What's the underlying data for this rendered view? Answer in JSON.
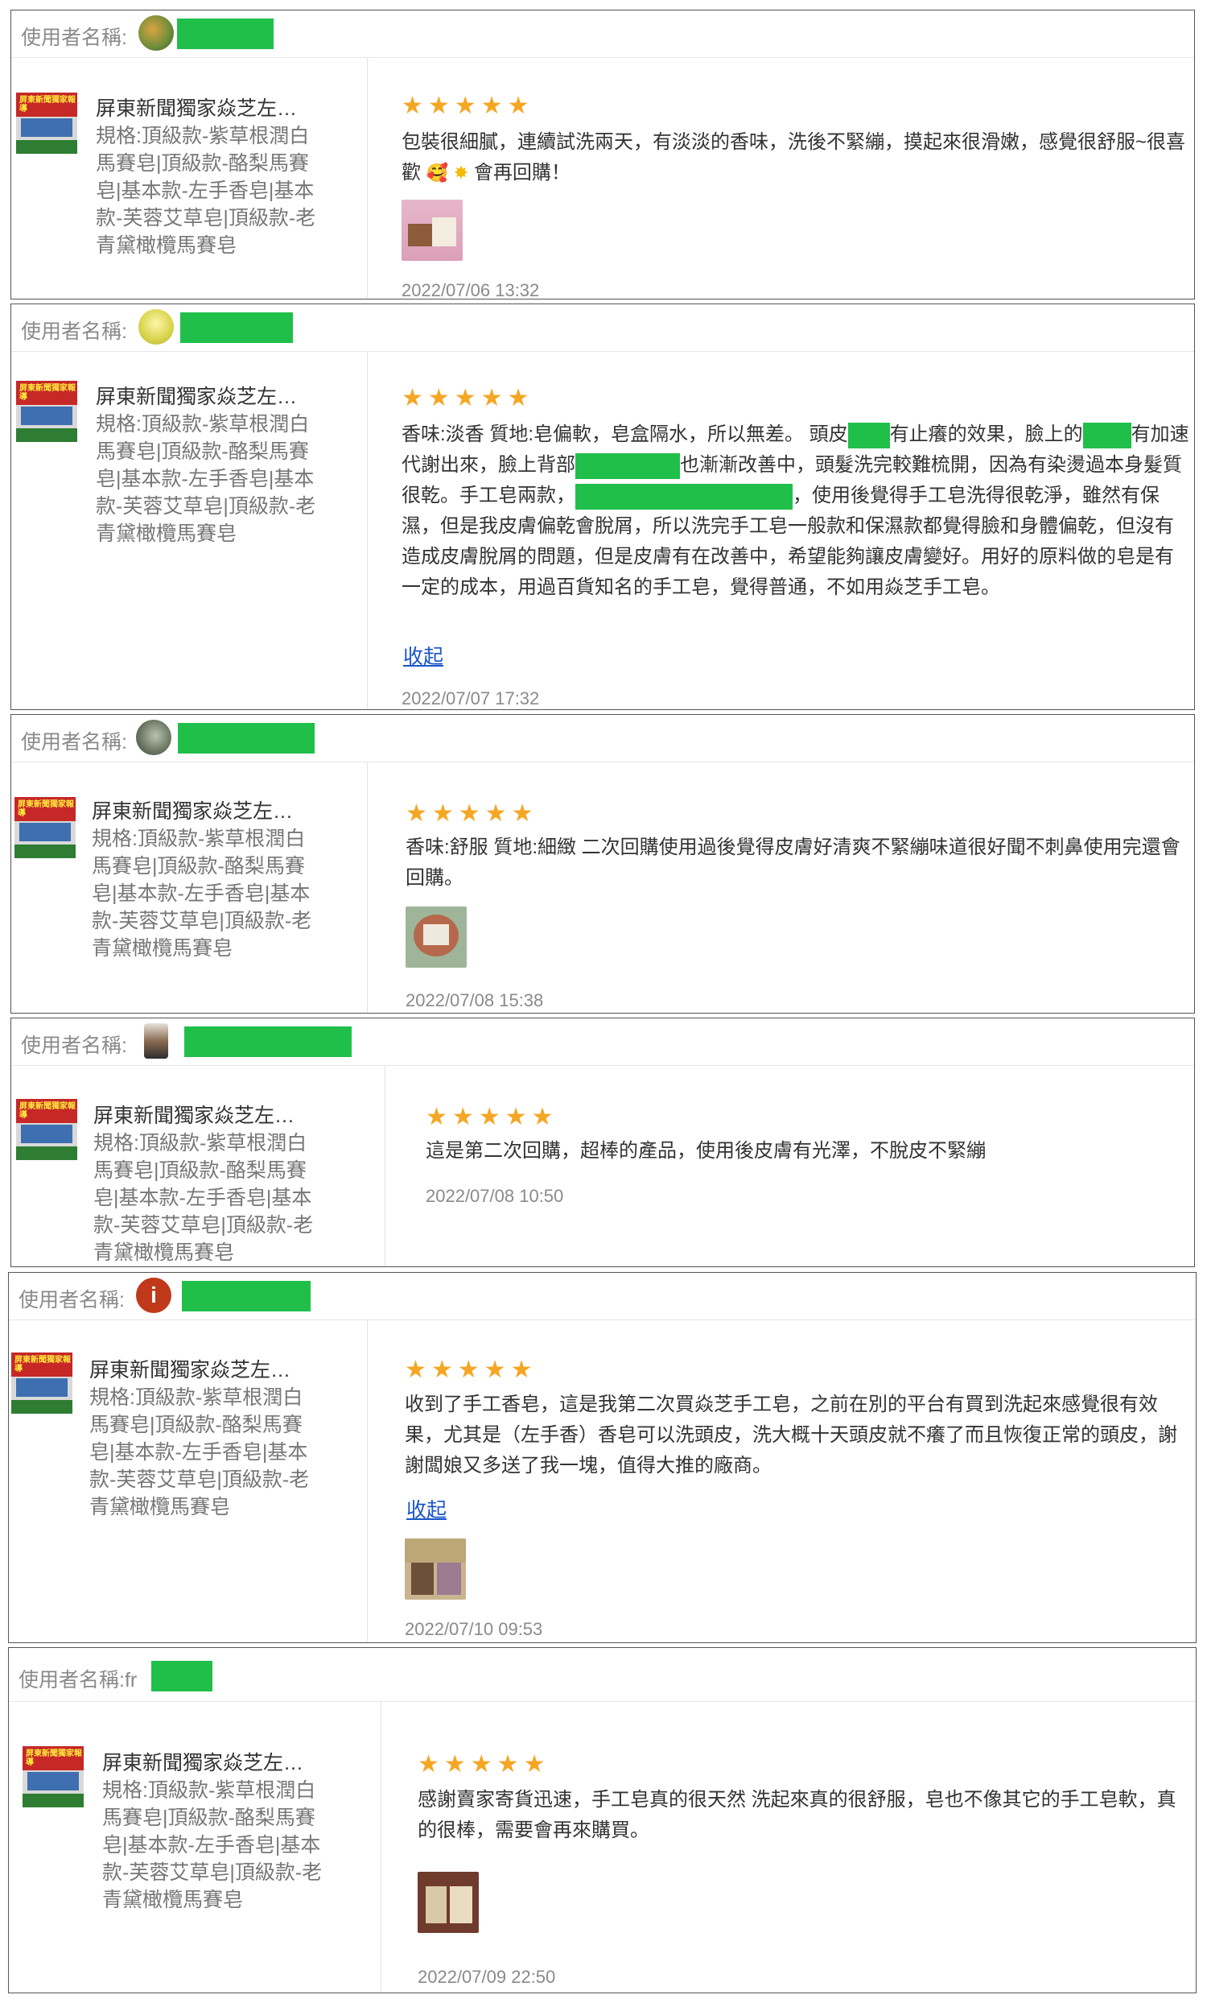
{
  "username_label": "使用者名稱:",
  "product_title": "屏東新聞獨家焱芝左…",
  "product_spec": "規格:頂級款-紫草根潤白馬賽皂|頂級款-酪梨馬賽皂|基本款-左手香皂|基本款-芙蓉艾草皂|頂級款-老青黛橄欖馬賽皂",
  "thumb_text": "屏東新聞獨家報導",
  "stars": "★★★★★",
  "collapse_label": "收起",
  "colors": {
    "star": "#f5a623",
    "redaction": "#1fbf4a",
    "link": "#1a56c9"
  },
  "reviews": [
    {
      "username_partial": "",
      "text_a": "包裝很細膩，連續試洗兩天，有淡淡的香味，洗後不緊繃，摸起來很滑嫩，感覺很舒服~很喜歡",
      "text_b": "會再回購！",
      "date": "2022/07/06 13:32"
    },
    {
      "username_partial": "",
      "t1": "香味:淡香 質地:皂偏軟，皂盒隔水，所以無差。 頭皮",
      "t2": "有止癢的效果，臉上的",
      "t3": "有加速代謝出來，臉上背部",
      "t4": "也漸漸改善中，頭髮洗完較難梳開，因為有染燙過本身髮質很乾。手工皂兩款，",
      "t5": "，使用後覺得手工皂洗得很乾淨，雖然有保濕，但是我皮膚偏乾會脫屑，所以洗完手工皂一般款和保濕款都覺得臉和身體偏乾，但沒有造成皮膚脫屑的問題，但是皮膚有在改善中，希望能夠讓皮膚變好。用好的原料做的皂是有一定的成本，用過百貨知名的手工皂，覺得普通，不如用焱芝手工皂。",
      "date": "2022/07/07 17:32"
    },
    {
      "username_partial": "",
      "text": "香味:舒服 質地:細緻 二次回購使用過後覺得皮膚好清爽不緊繃味道很好聞不刺鼻使用完還會回購。",
      "date": "2022/07/08 15:38"
    },
    {
      "username_partial": "",
      "text": "這是第二次回購，超棒的產品，使用後皮膚有光澤，不脫皮不緊繃",
      "date": "2022/07/08 10:50"
    },
    {
      "username_partial": "",
      "avatar_letter": "i",
      "text": "收到了手工香皂，這是我第二次買焱芝手工皂，之前在別的平台有買到洗起來感覺很有效果，尤其是（左手香）香皂可以洗頭皮，洗大概十天頭皮就不癢了而且恢復正常的頭皮，謝謝闆娘又多送了我一塊，值得大推的廠商。",
      "date": "2022/07/10 09:53"
    },
    {
      "username_partial": "fr",
      "text": "感謝賣家寄貨迅速，手工皂真的很天然 洗起來真的很舒服，皂也不像其它的手工皂軟，真的很棒，需要會再來購買。",
      "date": "2022/07/09 22:50"
    }
  ]
}
